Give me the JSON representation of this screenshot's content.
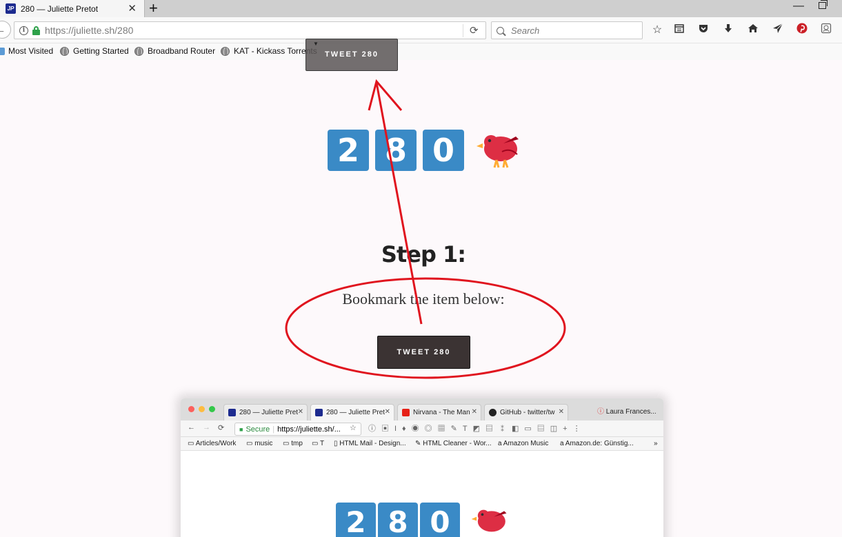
{
  "browser": {
    "tab_title": "280 — Juliette Pretot",
    "tab_favicon": "JP",
    "url_host": "https://juliette.sh",
    "url_path": "/280",
    "search_placeholder": "Search",
    "bookmarks": [
      "Most Visited",
      "Getting Started",
      "Broadband Router",
      "KAT - Kickass Torrents"
    ],
    "toolbar_icons": [
      "star-icon",
      "reader-icon",
      "pocket-icon",
      "download-icon",
      "home-icon",
      "send-icon",
      "pinterest-icon",
      "extension-icon"
    ]
  },
  "drag_ghost": {
    "label": "TWEET 280"
  },
  "page": {
    "counter_digits": [
      "2",
      "8",
      "0"
    ],
    "bird_icon": "red-bird-icon",
    "step_title": "Step 1:",
    "step_description": "Bookmark the item below:",
    "tweet_button_label": "TWEET 280"
  },
  "annotation": {
    "color": "#e0141e",
    "shapes": [
      "ellipse-around-step",
      "arrow-to-bookmarks-bar"
    ]
  },
  "embedded_screenshot": {
    "tabs": [
      "280 — Juliette Pret",
      "280 — Juliette Pret",
      "Nirvana - The Man",
      "GitHub - twitter/tw"
    ],
    "last_tab": "Laura Frances...",
    "secure_label": "Secure",
    "url": "https://juliette.sh/...",
    "bookmarks": [
      "Articles/Work",
      "music",
      "tmp",
      "T",
      "HTML Mail - Design...",
      "HTML Cleaner - Wor...",
      "Amazon Music",
      "Amazon.de: Günstig..."
    ],
    "counter_digits": [
      "2",
      "8",
      "0"
    ]
  },
  "colors": {
    "digit_blue": "#3a8ac6",
    "button_dark": "#3b3333",
    "page_bg": "#fdf9fb"
  }
}
